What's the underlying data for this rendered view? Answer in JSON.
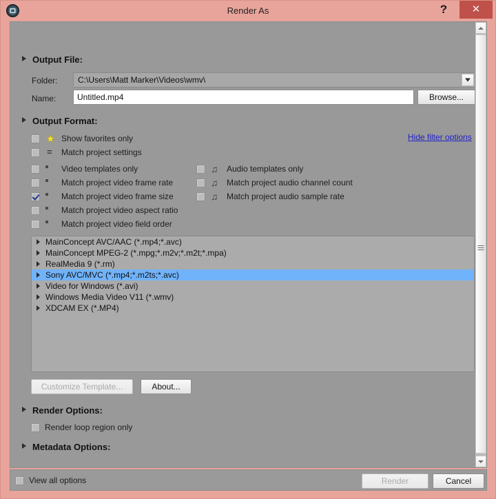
{
  "window": {
    "title": "Render As",
    "app_icon": "app-logo-icon",
    "help_label": "?",
    "close_label": "✕",
    "titlebar_color": "#e8a49b",
    "close_color": "#c0504a"
  },
  "sections": {
    "output_file": {
      "heading": "Output File:",
      "folder_label": "Folder:",
      "folder_value": "C:\\Users\\Matt Marker\\Videos\\wmv\\",
      "name_label": "Name:",
      "name_value": "Untitled.mp4",
      "name_placeholder": "Untitled.mp4",
      "browse_label": "Browse..."
    },
    "output_format": {
      "heading": "Output Format:",
      "hide_filter_link": "Hide filter options",
      "filters_left": [
        {
          "label": "Show favorites only",
          "checked": false,
          "icon": "star-icon"
        },
        {
          "label": "Match project settings",
          "checked": false,
          "icon": "equals-icon"
        },
        {
          "label": "Video templates only",
          "checked": false,
          "icon": "film-icon"
        },
        {
          "label": "Match project video frame rate",
          "checked": false,
          "icon": "film-icon"
        },
        {
          "label": "Match project video frame size",
          "checked": true,
          "icon": "film-icon"
        },
        {
          "label": "Match project video aspect ratio",
          "checked": false,
          "icon": "film-icon"
        },
        {
          "label": "Match project video field order",
          "checked": false,
          "icon": "film-icon"
        }
      ],
      "filters_right": [
        {
          "label": "Audio templates only",
          "checked": false,
          "icon": "music-note-icon"
        },
        {
          "label": "Match project audio channel count",
          "checked": false,
          "icon": "music-note-icon"
        },
        {
          "label": "Match project audio sample rate",
          "checked": false,
          "icon": "music-note-icon"
        }
      ],
      "formats": [
        {
          "label": "MainConcept AVC/AAC (*.mp4;*.avc)",
          "selected": false
        },
        {
          "label": "MainConcept MPEG-2 (*.mpg;*.m2v;*.m2t;*.mpa)",
          "selected": false
        },
        {
          "label": "RealMedia 9 (*.rm)",
          "selected": false
        },
        {
          "label": "Sony AVC/MVC (*.mp4;*.m2ts;*.avc)",
          "selected": true
        },
        {
          "label": "Video for Windows (*.avi)",
          "selected": false
        },
        {
          "label": "Windows Media Video V11 (*.wmv)",
          "selected": false
        },
        {
          "label": "XDCAM EX (*.MP4)",
          "selected": false
        }
      ],
      "selection_color": "#70b3fb",
      "customize_label": "Customize Template...",
      "customize_disabled": true,
      "about_label": "About..."
    },
    "render_options": {
      "heading": "Render Options:",
      "loop_region_label": "Render loop region only",
      "loop_region_checked": false
    },
    "metadata_options": {
      "heading": "Metadata Options:"
    }
  },
  "footer": {
    "view_all_label": "View all options",
    "view_all_checked": false,
    "render_label": "Render",
    "render_disabled": true,
    "cancel_label": "Cancel"
  },
  "scrollbar": {
    "up_arrow": "scroll-up-arrow-icon",
    "down_arrow": "scroll-down-arrow-icon"
  }
}
